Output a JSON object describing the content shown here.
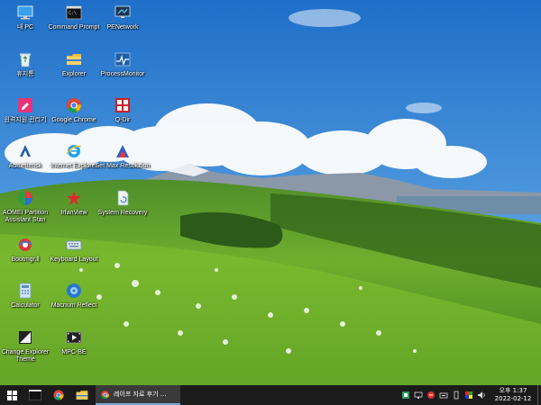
{
  "desktop": {
    "icons": [
      {
        "label": "내 PC",
        "icon": "monitor-icon"
      },
      {
        "label": "Command Prompt",
        "icon": "terminal-icon"
      },
      {
        "label": "PENetwork",
        "icon": "network-icon"
      },
      {
        "label": "휴지통",
        "icon": "recycle-bin-icon"
      },
      {
        "label": "Explorer",
        "icon": "folder-icon"
      },
      {
        "label": "ProcessMonitor",
        "icon": "process-monitor-icon"
      },
      {
        "label": "원격지원 관리기",
        "icon": "remote-support-icon"
      },
      {
        "label": "Google Chrome",
        "icon": "chrome-icon"
      },
      {
        "label": "Q-Dir",
        "icon": "qdir-icon"
      },
      {
        "label": "Aomeiterisk",
        "icon": "aomei-icon"
      },
      {
        "label": "Internet Explorer",
        "icon": "ie-icon"
      },
      {
        "label": "Set Max Resolution",
        "icon": "resolution-icon"
      },
      {
        "label": "AOMEI Partition Assistant Stan",
        "icon": "partition-icon"
      },
      {
        "label": "IrfanView",
        "icon": "irfanview-icon"
      },
      {
        "label": "System Recovery",
        "icon": "recovery-icon"
      },
      {
        "label": "Bootmgr.ll",
        "icon": "boot-icon"
      },
      {
        "label": "Keyboard Layout",
        "icon": "keyboard-icon"
      },
      {
        "label": "Calculator",
        "icon": "calculator-icon"
      },
      {
        "label": "Macrium Reflect",
        "icon": "macrium-icon"
      },
      {
        "label": "Change Explorer Theme",
        "icon": "theme-icon"
      },
      {
        "label": "MPC-BE",
        "icon": "mpc-icon"
      }
    ]
  },
  "taskbar": {
    "task_title": "레이프 자료 후기 ...",
    "clock_time": "오후 1:37",
    "clock_date": "2022-02-12"
  }
}
